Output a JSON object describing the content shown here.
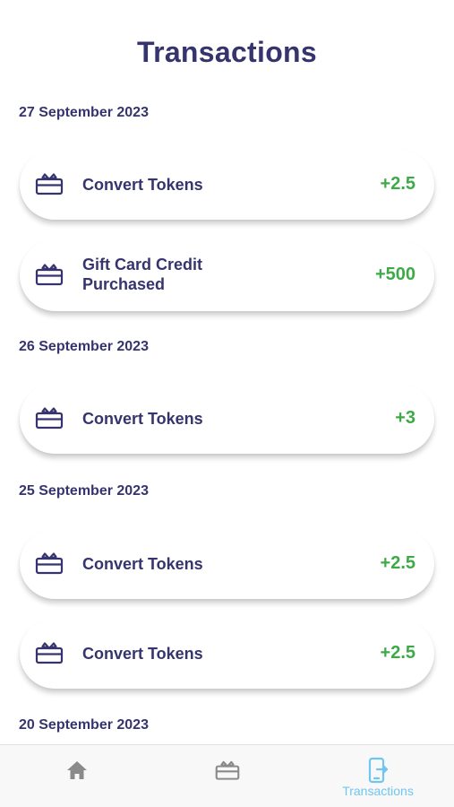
{
  "header": {
    "title": "Transactions"
  },
  "groups": [
    {
      "date": "27 September 2023",
      "items": [
        {
          "title": "Convert Tokens",
          "amount": "+2.5"
        },
        {
          "title": "Gift Card Credit Purchased",
          "amount": "+500"
        }
      ]
    },
    {
      "date": "26 September 2023",
      "items": [
        {
          "title": "Convert Tokens",
          "amount": "+3"
        }
      ]
    },
    {
      "date": "25 September 2023",
      "items": [
        {
          "title": "Convert Tokens",
          "amount": "+2.5"
        },
        {
          "title": "Convert Tokens",
          "amount": "+2.5"
        }
      ]
    },
    {
      "date": "20 September 2023",
      "items": []
    }
  ],
  "item_icon": "gift-card-icon",
  "nav": {
    "items": [
      {
        "icon": "home-icon",
        "label": ""
      },
      {
        "icon": "gift-card-icon",
        "label": ""
      },
      {
        "icon": "transactions-icon",
        "label": "Transactions",
        "active": true
      }
    ]
  },
  "colors": {
    "primary": "#35346e",
    "amount": "#3daa47",
    "nav_active": "#6fc6ee",
    "nav_inactive": "#8a8a8a",
    "nav_background": "#f8f8f8"
  }
}
